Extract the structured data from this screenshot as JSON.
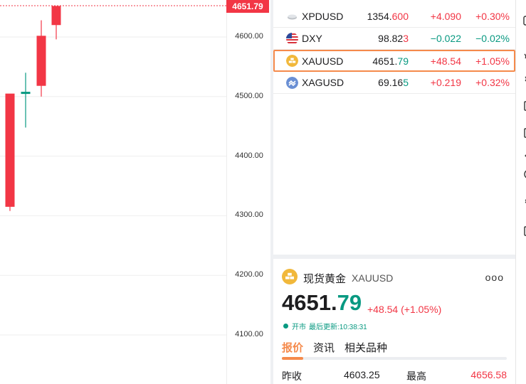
{
  "chart": {
    "price_tag": "4651.79",
    "y_ticks": [
      "4600.00",
      "4500.00",
      "4400.00",
      "4300.00",
      "4200.00",
      "4100.00"
    ],
    "colors": {
      "up": "#f23645",
      "down": "#089981"
    }
  },
  "chart_data": {
    "type": "candlestick",
    "title": "",
    "ylim": [
      4040,
      4660
    ],
    "y_ticks": [
      4600,
      4500,
      4400,
      4300,
      4200,
      4100
    ],
    "last_price_line": 4651.79,
    "candles": [
      {
        "open": 4315,
        "high": 4325,
        "low": 4308,
        "close": 4505,
        "direction": "up"
      },
      {
        "open": 4508,
        "high": 4540,
        "low": 4448,
        "close": 4505,
        "direction": "down"
      },
      {
        "open": 4518,
        "high": 4628,
        "low": 4500,
        "close": 4602,
        "direction": "up"
      },
      {
        "open": 4620,
        "high": 4652,
        "low": 4596,
        "close": 4652,
        "direction": "up"
      }
    ]
  },
  "watchlist": {
    "rows": [
      {
        "symbol": "XPDUSD",
        "price_main": "1354.",
        "price_tail": "600",
        "tail_dir": "up",
        "change": "+4.090",
        "pct": "+0.30%",
        "dir": "up",
        "icon": "palladium-bar-icon"
      },
      {
        "symbol": "DXY",
        "price_main": "98.82",
        "price_tail": "3",
        "tail_dir": "up",
        "change": "−0.022",
        "pct": "−0.02%",
        "dir": "down",
        "icon": "us-flag-icon"
      },
      {
        "symbol": "XAUUSD",
        "price_main": "4651.",
        "price_tail": "79",
        "tail_dir": "down",
        "change": "+48.54",
        "pct": "+1.05%",
        "dir": "up",
        "icon": "gold-coin-icon",
        "selected": true
      },
      {
        "symbol": "XAGUSD",
        "price_main": "69.16",
        "price_tail": "5",
        "tail_dir": "down",
        "change": "+0.219",
        "pct": "+0.32%",
        "dir": "up",
        "icon": "silver-coin-icon"
      }
    ]
  },
  "detail": {
    "name": "现货黄金",
    "symbol": "XAUUSD",
    "price_main": "4651.",
    "price_tail": "79",
    "change": "+48.54 (+1.05%)",
    "status": "开市",
    "last_update": "最后更新:10:38:31",
    "more": "ooo",
    "tabs": [
      "报价",
      "资讯",
      "相关品种"
    ],
    "stats": {
      "prev_close_label": "昨收",
      "prev_close": "4603.25",
      "high_label": "最高",
      "high": "4656.58"
    }
  }
}
